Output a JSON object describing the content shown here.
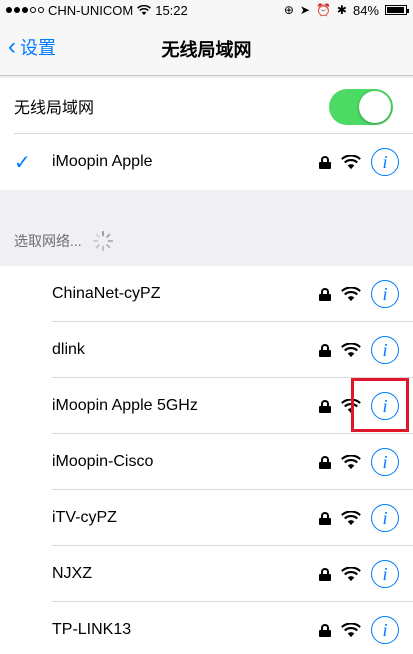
{
  "status_bar": {
    "carrier": "CHN-UNICOM",
    "time": "15:22",
    "battery": "84%",
    "battery_level": 0.84
  },
  "nav": {
    "back_label": "设置",
    "title": "无线局域网"
  },
  "wifi_toggle": {
    "label": "无线局域网",
    "on": true
  },
  "connected": {
    "name": "iMoopin Apple"
  },
  "section_label": "选取网络...",
  "networks": [
    {
      "name": "ChinaNet-cyPZ"
    },
    {
      "name": "dlink"
    },
    {
      "name": "iMoopin Apple 5GHz"
    },
    {
      "name": "iMoopin-Cisco"
    },
    {
      "name": "iTV-cyPZ"
    },
    {
      "name": "NJXZ"
    },
    {
      "name": "TP-LINK13"
    }
  ],
  "colors": {
    "accent": "#007aff",
    "toggle_on": "#4cd964",
    "highlight": "#e0162b"
  },
  "icons": {
    "lock": "lock-icon",
    "wifi": "wifi-icon",
    "info": "info-icon"
  }
}
